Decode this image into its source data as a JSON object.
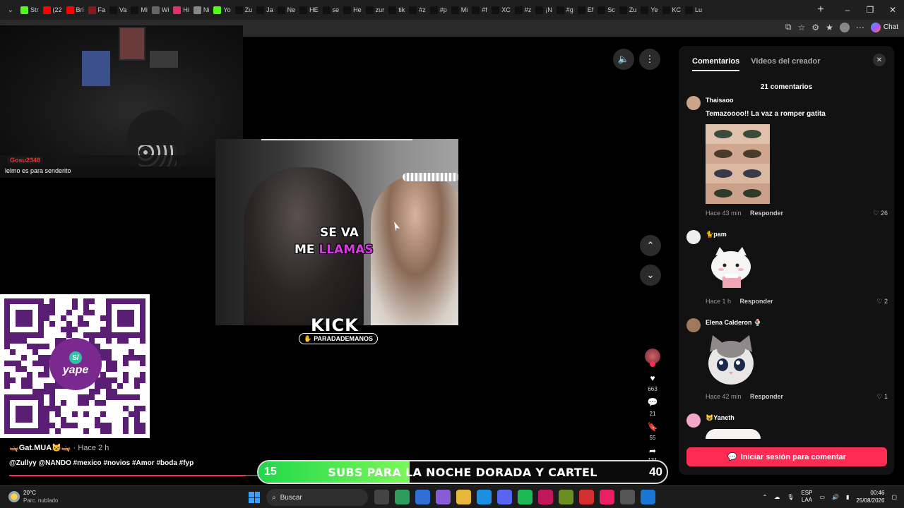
{
  "browser": {
    "tabs": [
      {
        "label": "Str",
        "color": "#53fc18"
      },
      {
        "label": "(22",
        "color": "#ff0000"
      },
      {
        "label": "Bri",
        "color": "#ff0000"
      },
      {
        "label": "Fa",
        "color": "#8a1a1a"
      },
      {
        "label": "Va",
        "color": "#111111"
      },
      {
        "label": "Mi",
        "color": "#111111"
      },
      {
        "label": "Wi",
        "color": "#666666"
      },
      {
        "label": "Hi",
        "color": "#e1306c"
      },
      {
        "label": "Ni",
        "color": "#888888"
      },
      {
        "label": "Yo",
        "color": "#53fc18"
      },
      {
        "label": "Zu",
        "color": "#111111"
      },
      {
        "label": "Ja",
        "color": "#111111"
      },
      {
        "label": "Ne",
        "color": "#111111"
      },
      {
        "label": "HE",
        "color": "#111111"
      },
      {
        "label": "se",
        "color": "#111111"
      },
      {
        "label": "He",
        "color": "#111111"
      },
      {
        "label": "zur",
        "color": "#111111"
      },
      {
        "label": "tik",
        "color": "#111111"
      },
      {
        "label": "#z",
        "color": "#111111"
      },
      {
        "label": "#p",
        "color": "#111111"
      },
      {
        "label": "Mi",
        "color": "#111111"
      },
      {
        "label": "#f",
        "color": "#111111"
      },
      {
        "label": "XC",
        "color": "#111111"
      },
      {
        "label": "#z",
        "color": "#111111"
      },
      {
        "label": "¡N",
        "color": "#111111"
      },
      {
        "label": "#g",
        "color": "#111111"
      },
      {
        "label": "Ef",
        "color": "#111111"
      },
      {
        "label": "Sc",
        "color": "#111111"
      },
      {
        "label": "Zu",
        "color": "#111111"
      },
      {
        "label": "Ye",
        "color": "#111111"
      },
      {
        "label": "KC",
        "color": "#111111"
      },
      {
        "label": "Lu",
        "color": "#111111"
      }
    ],
    "active_tab_label": "",
    "chat_label": "Chat"
  },
  "stream": {
    "chat_user": "Gosu2348",
    "chat_message": "lelmo es para senderito"
  },
  "video": {
    "caption_line1": "SE VA",
    "caption_line2a": "ME",
    "caption_line2b": "LLAMAS",
    "watermark_logo": "KICK",
    "watermark_handle": "PARADADEMANOS",
    "author": "🛶Gat.MUA😺🛶",
    "time": "· Hace 2 h",
    "description": "@Zullyy @NANDO #mexico #novios #Amor #boda #fyp",
    "progress": 0.36
  },
  "actions": {
    "likes": "663",
    "comments": "21",
    "saves": "55",
    "shares": "131"
  },
  "subs_goal": {
    "current": "15",
    "text": "SUBS PARA LA NOCHE DORADA Y CARTEL",
    "goal": "40",
    "fill": 0.37
  },
  "panel": {
    "tab_comments": "Comentarios",
    "tab_creator": "Videos del creador",
    "count_label": "21 comentarios",
    "reply_label": "Responder",
    "login_label": "Iniciar sesión para comentar",
    "comments": [
      {
        "user": "Thaisaoo",
        "text": "Temazoooo!! La vaz a romper gatita",
        "time": "Hace 43 min",
        "likes": "26",
        "avatar": "#c9a58c"
      },
      {
        "user": "🐈pam",
        "text": "",
        "time": "Hace 1 h",
        "likes": "2",
        "avatar": "#eeeeee"
      },
      {
        "user": "Elena Calderon 🍨",
        "text": "",
        "time": "Hace 42 min",
        "likes": "1",
        "avatar": "#a0785e"
      },
      {
        "user": "😺Yaneth",
        "text": "",
        "time": "",
        "likes": "",
        "avatar": "#f3a6c8"
      }
    ]
  },
  "taskbar": {
    "temp": "20°C",
    "weather": "Parc. nublado",
    "search": "Buscar",
    "lang1": "ESP",
    "lang2": "LAA",
    "time": "00:46",
    "date": "25/08/2026"
  },
  "colors": {
    "accent": "#fe2c55",
    "kick_green": "#53fc18",
    "caption_highlight": "#d63be6"
  }
}
